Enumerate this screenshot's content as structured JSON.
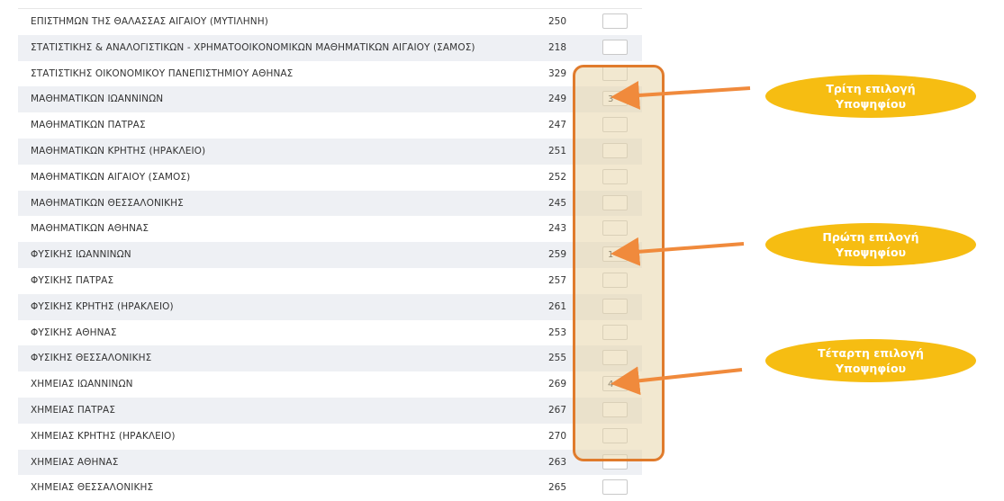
{
  "rows": [
    {
      "name": "ΕΠΙΣΤΗΜΩΝ ΤΗΣ ΘΑΛΑΣΣΑΣ ΑΙΓΑΙΟΥ (ΜΥΤΙΛΗΝΗ)",
      "code": "250",
      "choice": ""
    },
    {
      "name": "ΣΤΑΤΙΣΤΙΚΗΣ & ΑΝΑΛΟΓΙΣΤΙΚΩΝ - ΧΡΗΜΑΤΟΟΙΚΟΝΟΜΙΚΩΝ ΜΑΘΗΜΑΤΙΚΩΝ ΑΙΓΑΙΟΥ (ΣΑΜΟΣ)",
      "code": "218",
      "choice": ""
    },
    {
      "name": "ΣΤΑΤΙΣΤΙΚΗΣ ΟΙΚΟΝΟΜΙΚΟΥ ΠΑΝΕΠΙΣΤΗΜΙΟΥ ΑΘΗΝΑΣ",
      "code": "329",
      "choice": ""
    },
    {
      "name": "ΜΑΘΗΜΑΤΙΚΩΝ ΙΩΑΝΝΙΝΩΝ",
      "code": "249",
      "choice": "3"
    },
    {
      "name": "ΜΑΘΗΜΑΤΙΚΩΝ ΠΑΤΡΑΣ",
      "code": "247",
      "choice": ""
    },
    {
      "name": "ΜΑΘΗΜΑΤΙΚΩΝ ΚΡΗΤΗΣ (ΗΡΑΚΛΕΙΟ)",
      "code": "251",
      "choice": ""
    },
    {
      "name": "ΜΑΘΗΜΑΤΙΚΩΝ ΑΙΓΑΙΟΥ (ΣΑΜΟΣ)",
      "code": "252",
      "choice": ""
    },
    {
      "name": "ΜΑΘΗΜΑΤΙΚΩΝ ΘΕΣΣΑΛΟΝΙΚΗΣ",
      "code": "245",
      "choice": ""
    },
    {
      "name": "ΜΑΘΗΜΑΤΙΚΩΝ ΑΘΗΝΑΣ",
      "code": "243",
      "choice": ""
    },
    {
      "name": "ΦΥΣΙΚΗΣ ΙΩΑΝΝΙΝΩΝ",
      "code": "259",
      "choice": "1"
    },
    {
      "name": "ΦΥΣΙΚΗΣ ΠΑΤΡΑΣ",
      "code": "257",
      "choice": ""
    },
    {
      "name": "ΦΥΣΙΚΗΣ ΚΡΗΤΗΣ (ΗΡΑΚΛΕΙΟ)",
      "code": "261",
      "choice": ""
    },
    {
      "name": "ΦΥΣΙΚΗΣ ΑΘΗΝΑΣ",
      "code": "253",
      "choice": ""
    },
    {
      "name": "ΦΥΣΙΚΗΣ ΘΕΣΣΑΛΟΝΙΚΗΣ",
      "code": "255",
      "choice": ""
    },
    {
      "name": "ΧΗΜΕΙΑΣ ΙΩΑΝΝΙΝΩΝ",
      "code": "269",
      "choice": "4"
    },
    {
      "name": "ΧΗΜΕΙΑΣ ΠΑΤΡΑΣ",
      "code": "267",
      "choice": ""
    },
    {
      "name": "ΧΗΜΕΙΑΣ ΚΡΗΤΗΣ (ΗΡΑΚΛΕΙΟ)",
      "code": "270",
      "choice": ""
    },
    {
      "name": "ΧΗΜΕΙΑΣ ΑΘΗΝΑΣ",
      "code": "263",
      "choice": ""
    },
    {
      "name": "ΧΗΜΕΙΑΣ ΘΕΣΣΑΛΟΝΙΚΗΣ",
      "code": "265",
      "choice": ""
    }
  ],
  "callouts": [
    {
      "line1": "Τρίτη επιλογή",
      "line2": "Υποψηφίου"
    },
    {
      "line1": "Πρώτη επιλογή",
      "line2": "Υποψηφίου"
    },
    {
      "line1": "Τέταρτη επιλογή",
      "line2": "Υποψηφίου"
    }
  ],
  "colors": {
    "highlight_border": "#e07b2c",
    "highlight_fill": "#e8d6aa",
    "callout_fill": "#f6bd12",
    "arrow": "#f08a3c",
    "row_shade": "#eef0f4"
  }
}
